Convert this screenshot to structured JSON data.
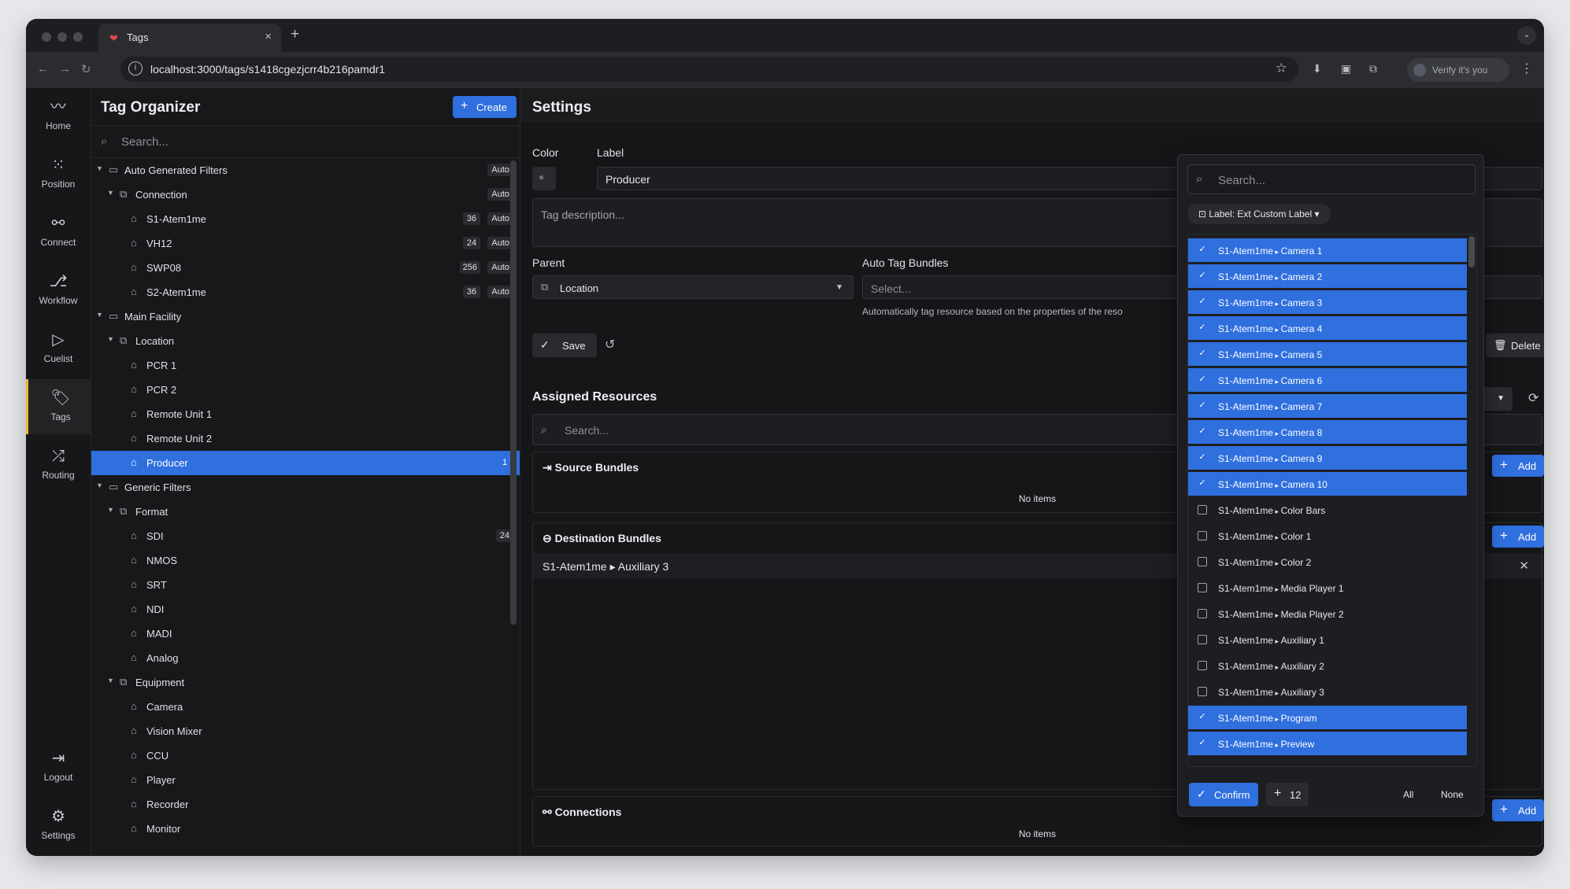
{
  "browser": {
    "tab_title": "Tags",
    "tab_close": "×",
    "new_tab": "+",
    "url": "localhost:3000/tags/s1418cgezjcrr4b216pamdr1",
    "verify": "Verify it's you"
  },
  "rail": [
    {
      "label": "Home",
      "icon": "pulse-icon",
      "glyph": "〰"
    },
    {
      "label": "Position",
      "icon": "grid-icon",
      "glyph": "⁙"
    },
    {
      "label": "Connect",
      "icon": "plug-icon",
      "glyph": "⚯"
    },
    {
      "label": "Workflow",
      "icon": "workflow-icon",
      "glyph": "⎇"
    },
    {
      "label": "Cuelist",
      "icon": "play-icon",
      "glyph": "▷"
    },
    {
      "label": "Tags",
      "icon": "tag-icon",
      "glyph": "🏷",
      "active": true
    },
    {
      "label": "Routing",
      "icon": "shuffle-icon",
      "glyph": "⤮"
    },
    {
      "label": "Logout",
      "icon": "logout-icon",
      "glyph": "⇥"
    },
    {
      "label": "Settings",
      "icon": "gear-icon",
      "glyph": "⚙"
    }
  ],
  "tree": {
    "title": "Tag Organizer",
    "create_label": "Create",
    "search_placeholder": "Search...",
    "rows": [
      {
        "level": 0,
        "type": "folder",
        "label": "Auto Generated Filters",
        "auto": "Auto"
      },
      {
        "level": 1,
        "type": "group",
        "label": "Connection",
        "auto": "Auto"
      },
      {
        "level": 2,
        "type": "tag",
        "label": "S1-Atem1me",
        "count": "36",
        "auto": "Auto"
      },
      {
        "level": 2,
        "type": "tag",
        "label": "VH12",
        "count": "24",
        "auto": "Auto"
      },
      {
        "level": 2,
        "type": "tag",
        "label": "SWP08",
        "count": "256",
        "auto": "Auto"
      },
      {
        "level": 2,
        "type": "tag",
        "label": "S2-Atem1me",
        "count": "36",
        "auto": "Auto"
      },
      {
        "level": 0,
        "type": "folder",
        "label": "Main Facility"
      },
      {
        "level": 1,
        "type": "group",
        "label": "Location"
      },
      {
        "level": 2,
        "type": "tag",
        "label": "PCR 1"
      },
      {
        "level": 2,
        "type": "tag",
        "label": "PCR 2"
      },
      {
        "level": 2,
        "type": "tag",
        "label": "Remote Unit 1"
      },
      {
        "level": 2,
        "type": "tag",
        "label": "Remote Unit 2"
      },
      {
        "level": 2,
        "type": "tag",
        "label": "Producer",
        "count": "1",
        "selected": true
      },
      {
        "level": 0,
        "type": "folder",
        "label": "Generic Filters"
      },
      {
        "level": 1,
        "type": "group",
        "label": "Format"
      },
      {
        "level": 2,
        "type": "tag",
        "label": "SDI",
        "count": "24"
      },
      {
        "level": 2,
        "type": "tag",
        "label": "NMOS"
      },
      {
        "level": 2,
        "type": "tag",
        "label": "SRT"
      },
      {
        "level": 2,
        "type": "tag",
        "label": "NDI"
      },
      {
        "level": 2,
        "type": "tag",
        "label": "MADI"
      },
      {
        "level": 2,
        "type": "tag",
        "label": "Analog"
      },
      {
        "level": 1,
        "type": "group",
        "label": "Equipment"
      },
      {
        "level": 2,
        "type": "tag",
        "label": "Camera"
      },
      {
        "level": 2,
        "type": "tag",
        "label": "Vision Mixer"
      },
      {
        "level": 2,
        "type": "tag",
        "label": "CCU"
      },
      {
        "level": 2,
        "type": "tag",
        "label": "Player"
      },
      {
        "level": 2,
        "type": "tag",
        "label": "Recorder"
      },
      {
        "level": 2,
        "type": "tag",
        "label": "Monitor"
      }
    ]
  },
  "settings": {
    "title": "Settings",
    "color_label": "Color",
    "label_label": "Label",
    "label_value": "Producer",
    "description_placeholder": "Tag description...",
    "parent_label": "Parent",
    "parent_value": "Location",
    "auto_bundles_label": "Auto Tag Bundles",
    "auto_bundles_placeholder": "Select...",
    "auto_help": "Automatically tag resource based on the properties of the reso",
    "save_label": "Save",
    "delete_label": "Delete"
  },
  "assigned": {
    "title": "Assigned Resources",
    "search_placeholder": "Search...",
    "source_title": "Source Bundles",
    "source_empty": "No items",
    "dest_title": "Destination Bundles",
    "dest_item_device": "S1-Atem1me",
    "dest_item_name": "Auxiliary 3",
    "connections_title": "Connections",
    "connections_empty": "No items",
    "add_label": "Add"
  },
  "dropdown": {
    "search_placeholder": "Search...",
    "filter_chip": "Label: Ext Custom Label",
    "items": [
      {
        "device": "S1-Atem1me",
        "name": "Camera 1",
        "checked": true
      },
      {
        "device": "S1-Atem1me",
        "name": "Camera 2",
        "checked": true
      },
      {
        "device": "S1-Atem1me",
        "name": "Camera 3",
        "checked": true
      },
      {
        "device": "S1-Atem1me",
        "name": "Camera 4",
        "checked": true
      },
      {
        "device": "S1-Atem1me",
        "name": "Camera 5",
        "checked": true
      },
      {
        "device": "S1-Atem1me",
        "name": "Camera 6",
        "checked": true
      },
      {
        "device": "S1-Atem1me",
        "name": "Camera 7",
        "checked": true
      },
      {
        "device": "S1-Atem1me",
        "name": "Camera 8",
        "checked": true
      },
      {
        "device": "S1-Atem1me",
        "name": "Camera 9",
        "checked": true
      },
      {
        "device": "S1-Atem1me",
        "name": "Camera 10",
        "checked": true
      },
      {
        "device": "S1-Atem1me",
        "name": "Color Bars",
        "checked": false
      },
      {
        "device": "S1-Atem1me",
        "name": "Color 1",
        "checked": false
      },
      {
        "device": "S1-Atem1me",
        "name": "Color 2",
        "checked": false
      },
      {
        "device": "S1-Atem1me",
        "name": "Media Player 1",
        "checked": false
      },
      {
        "device": "S1-Atem1me",
        "name": "Media Player 2",
        "checked": false
      },
      {
        "device": "S1-Atem1me",
        "name": "Auxiliary 1",
        "checked": false
      },
      {
        "device": "S1-Atem1me",
        "name": "Auxiliary 2",
        "checked": false
      },
      {
        "device": "S1-Atem1me",
        "name": "Auxiliary 3",
        "checked": false
      },
      {
        "device": "S1-Atem1me",
        "name": "Program",
        "checked": true
      },
      {
        "device": "S1-Atem1me",
        "name": "Preview",
        "checked": true
      }
    ],
    "confirm_label": "Confirm",
    "plus_count": "12",
    "all_label": "All",
    "none_label": "None"
  },
  "colors": {
    "accent": "#2f6fde",
    "active_rail": "#f0b429"
  }
}
